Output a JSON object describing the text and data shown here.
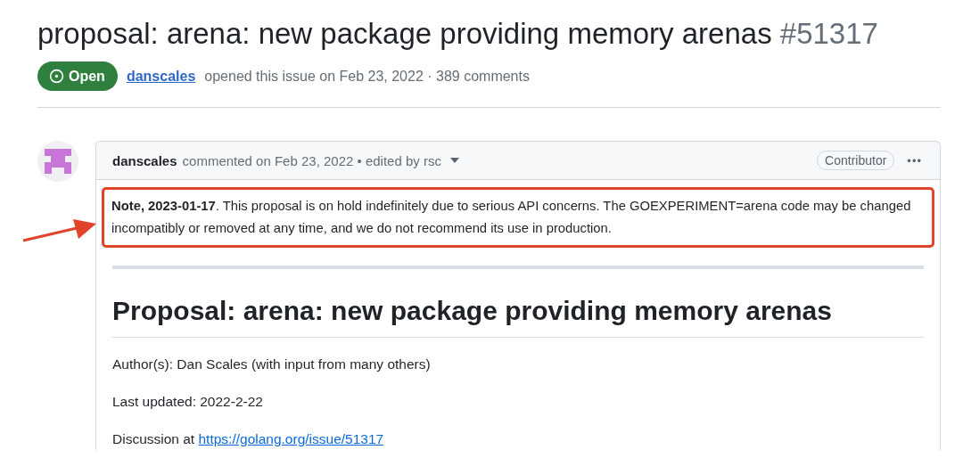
{
  "issue": {
    "title": "proposal: arena: new package providing memory arenas",
    "number": "#51317",
    "state": "Open",
    "author": "danscales",
    "meta": "opened this issue on Feb 23, 2022 · 389 comments"
  },
  "comment": {
    "author": "danscales",
    "meta": "commented on Feb 23, 2022 • edited by rsc",
    "role": "Contributor",
    "menu": "•••",
    "note": {
      "text": "**Note, 2023-01-17**. This proposal is on hold indefinitely due to serious API concerns. The GOEXPERIMENT=arena code may be changed incompatibly or removed at any time, and we do not recommend its use in production.",
      "highlighted": true
    },
    "heading": "Proposal: arena: new package providing memory arenas",
    "paragraphs": [
      {
        "kind": "text",
        "text": "Author(s): Dan Scales (with input from many others)"
      },
      {
        "kind": "text",
        "text": "Last updated: 2022-2-22"
      },
      {
        "kind": "link",
        "text": "Discussion at ",
        "link": "https://golang.org/issue/51317"
      }
    ]
  }
}
